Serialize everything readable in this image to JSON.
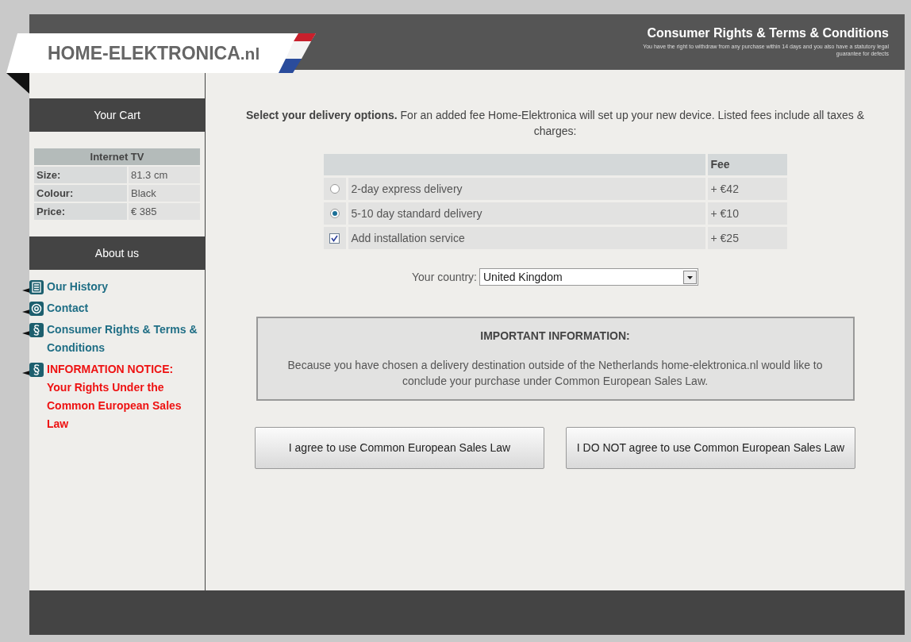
{
  "logo": {
    "main": "HOME-ELEKTRONICA",
    "suffix": ".nl"
  },
  "header": {
    "title": "Consumer Rights & Terms & Conditions",
    "subtitle": "You have the right to withdraw from any purchase within 14 days and you also have a statutory legal guarantee for defects"
  },
  "cart": {
    "heading": "Your Cart",
    "product": "Internet TV",
    "rows": [
      {
        "label": "Size:",
        "value": "81.3 cm"
      },
      {
        "label": "Colour:",
        "value": "Black"
      },
      {
        "label": "Price:",
        "value": "€ 385"
      }
    ]
  },
  "about": {
    "heading": "About us",
    "links": [
      {
        "label": "Our History",
        "kind": "link"
      },
      {
        "label": "Contact",
        "kind": "link"
      },
      {
        "label": "Consumer Rights & Terms & Conditions",
        "kind": "link"
      },
      {
        "label": "INFORMATION NOTICE: Your Rights Under the Common European Sales Law",
        "kind": "notice"
      }
    ]
  },
  "intro": "**Select your delivery options.** For an added fee Home-Elektronica will set up your new device. Listed fees include all taxes & charges:",
  "options": {
    "fee_header": "Fee",
    "rows": [
      {
        "kind": "radio",
        "label": "2-day express delivery",
        "fee": "+ €42",
        "selected": false
      },
      {
        "kind": "radio",
        "label": "5-10 day standard delivery",
        "fee": "+ €10",
        "selected": true
      },
      {
        "kind": "checkbox",
        "label": "Add installation service",
        "fee": "+ €25",
        "selected": true
      }
    ]
  },
  "country": {
    "label": "Your country:",
    "value": "United Kingdom"
  },
  "notice": {
    "title": "IMPORTANT INFORMATION:",
    "text": "Because you have chosen a delivery destination outside of the Netherlands home-elektronica.nl would like to conclude your purchase under Common European Sales Law."
  },
  "buttons": [
    "I agree to use Common European Sales Law",
    "I DO NOT agree to use Common European Sales Law"
  ]
}
